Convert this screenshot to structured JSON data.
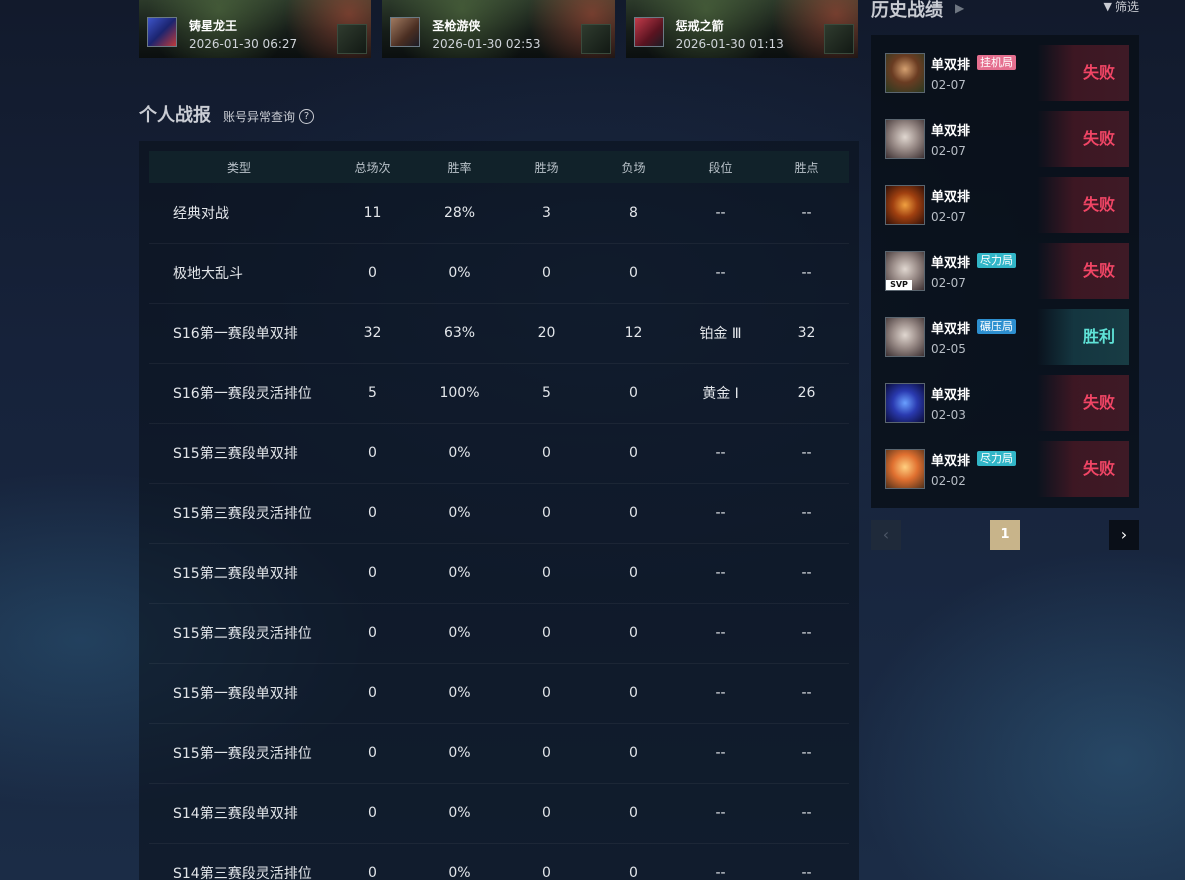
{
  "recent_matches": [
    {
      "champion": "铸星龙王",
      "time": "2026-01-30 06:27"
    },
    {
      "champion": "圣枪游侠",
      "time": "2026-01-30 02:53"
    },
    {
      "champion": "惩戒之箭",
      "time": "2026-01-30 01:13"
    }
  ],
  "stats": {
    "title": "个人战报",
    "abnormal_link": "账号异常查询",
    "help_glyph": "?",
    "columns": [
      "类型",
      "总场次",
      "胜率",
      "胜场",
      "负场",
      "段位",
      "胜点"
    ],
    "rows": [
      [
        "经典对战",
        "11",
        "28%",
        "3",
        "8",
        "--",
        "--"
      ],
      [
        "极地大乱斗",
        "0",
        "0%",
        "0",
        "0",
        "--",
        "--"
      ],
      [
        "S16第一赛段单双排",
        "32",
        "63%",
        "20",
        "12",
        "铂金 Ⅲ",
        "32"
      ],
      [
        "S16第一赛段灵活排位",
        "5",
        "100%",
        "5",
        "0",
        "黄金 Ⅰ",
        "26"
      ],
      [
        "S15第三赛段单双排",
        "0",
        "0%",
        "0",
        "0",
        "--",
        "--"
      ],
      [
        "S15第三赛段灵活排位",
        "0",
        "0%",
        "0",
        "0",
        "--",
        "--"
      ],
      [
        "S15第二赛段单双排",
        "0",
        "0%",
        "0",
        "0",
        "--",
        "--"
      ],
      [
        "S15第二赛段灵活排位",
        "0",
        "0%",
        "0",
        "0",
        "--",
        "--"
      ],
      [
        "S15第一赛段单双排",
        "0",
        "0%",
        "0",
        "0",
        "--",
        "--"
      ],
      [
        "S15第一赛段灵活排位",
        "0",
        "0%",
        "0",
        "0",
        "--",
        "--"
      ],
      [
        "S14第三赛段单双排",
        "0",
        "0%",
        "0",
        "0",
        "--",
        "--"
      ],
      [
        "S14第三赛段灵活排位",
        "0",
        "0%",
        "0",
        "0",
        "--",
        "--"
      ]
    ]
  },
  "history": {
    "title": "历史战绩",
    "filter_label": "筛选",
    "filter_icon": "funnel-icon",
    "matches": [
      {
        "mode": "单双排",
        "tag": "挂机局",
        "tag_color": "#e56f8f",
        "date": "02-07",
        "result": "失败",
        "outcome": "lose"
      },
      {
        "mode": "单双排",
        "tag": "",
        "tag_color": "",
        "date": "02-07",
        "result": "失败",
        "outcome": "lose"
      },
      {
        "mode": "单双排",
        "tag": "",
        "tag_color": "",
        "date": "02-07",
        "result": "失败",
        "outcome": "lose"
      },
      {
        "mode": "单双排",
        "tag": "尽力局",
        "tag_color": "#32b6c8",
        "date": "02-07",
        "result": "失败",
        "outcome": "lose",
        "badge": "SVP"
      },
      {
        "mode": "单双排",
        "tag": "碾压局",
        "tag_color": "#2d8fd0",
        "date": "02-05",
        "result": "胜利",
        "outcome": "win"
      },
      {
        "mode": "单双排",
        "tag": "",
        "tag_color": "",
        "date": "02-03",
        "result": "失败",
        "outcome": "lose"
      },
      {
        "mode": "单双排",
        "tag": "尽力局",
        "tag_color": "#32b6c8",
        "date": "02-02",
        "result": "失败",
        "outcome": "lose"
      }
    ]
  },
  "pagination": {
    "current_page": "1",
    "prev_icon": "chevron-left-icon",
    "next_icon": "chevron-right-icon"
  },
  "colors": {
    "lose": "#f04565",
    "win": "#5fe2d6",
    "page_active": "#c8b48a"
  }
}
